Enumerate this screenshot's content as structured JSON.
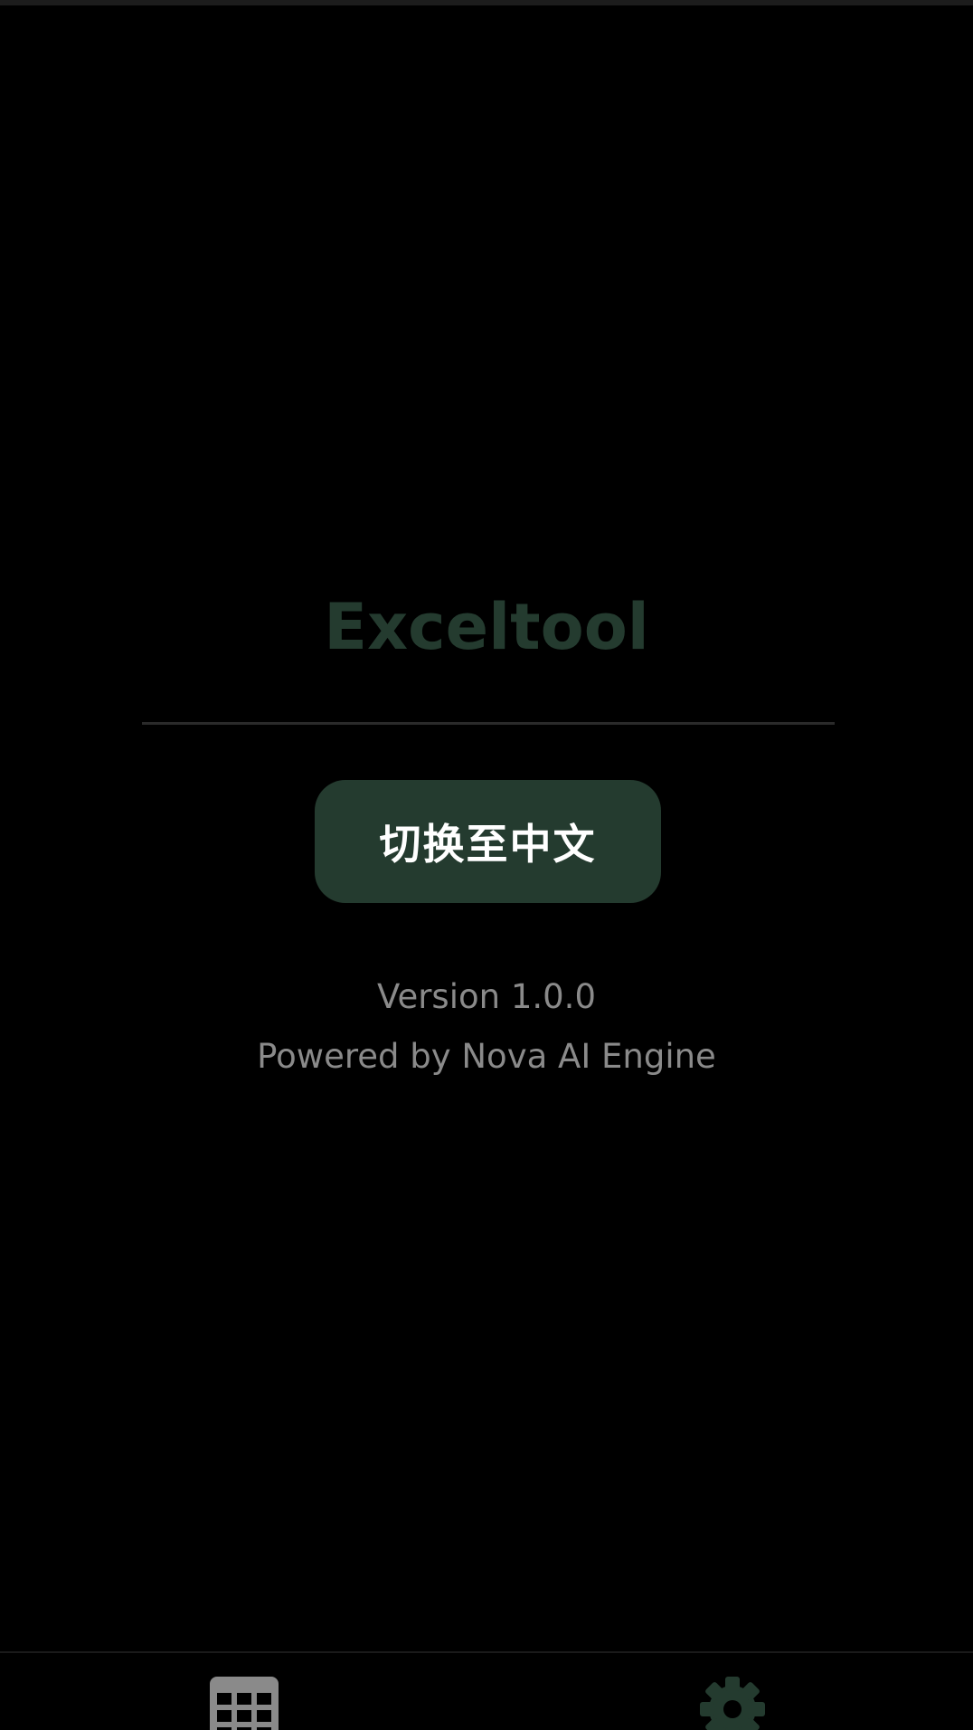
{
  "app": {
    "title": "Exceltool"
  },
  "settings": {
    "language_button_label": "切换至中文",
    "version_text": "Version 1.0.0",
    "powered_by_text": "Powered by Nova AI Engine"
  },
  "bottom_nav": {
    "items": [
      {
        "icon": "grid-icon",
        "active": false,
        "color": "#8a8a8a"
      },
      {
        "icon": "gear-icon",
        "active": true,
        "color": "#243b2f"
      }
    ]
  },
  "colors": {
    "accent": "#243b2f",
    "background": "#000000",
    "muted_text": "#8a8a8a"
  }
}
